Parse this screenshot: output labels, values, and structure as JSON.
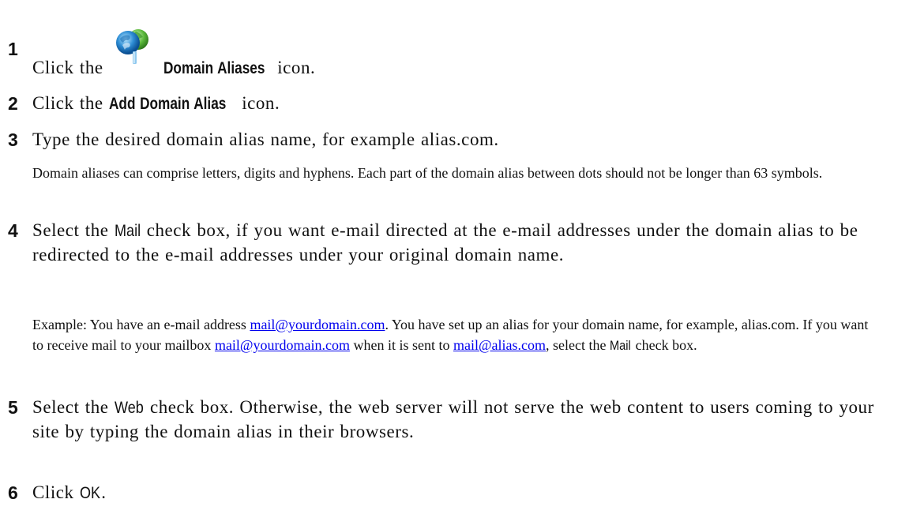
{
  "steps": [
    {
      "num": "1",
      "pre": "Click the",
      "ui": "Domain Aliases",
      "post": "icon.",
      "icon": "domain-aliases-icon"
    },
    {
      "num": "2",
      "pre": "Click the",
      "ui": "Add Domain Alias",
      "post": "icon."
    },
    {
      "num": "3",
      "text": "Type the desired domain alias name, for example alias.com."
    },
    {
      "num": "4",
      "pre": "Select the",
      "ui": "Mail",
      "post": "check box, if you want e-mail directed at the e-mail addresses under the domain alias to be redirected to the e-mail addresses under your original domain name."
    },
    {
      "num": "5",
      "pre": "Select the",
      "ui": "Web",
      "post": "check box. Otherwise, the web server will not serve the web content to users coming to your site by typing the domain alias in their browsers."
    },
    {
      "num": "6",
      "pre": "Click",
      "ui": "OK",
      "post": "."
    }
  ],
  "notes": {
    "step3": "Domain aliases can comprise letters, digits and hyphens. Each part of the domain alias between dots should not be longer than 63 symbols.",
    "step4": {
      "part1": "Example: You have an e-mail address",
      "link1": "mail@yourdomain.com",
      "part2": ". You have set up an alias for your domain name, for example, alias.com. If you want to receive mail to your mailbox",
      "link2": "mail@yourdomain.com",
      "part3": "when it is sent to",
      "link3": "mail@alias.com",
      "part4": ", select the",
      "ui": "Mail",
      "part5": "check box."
    }
  }
}
